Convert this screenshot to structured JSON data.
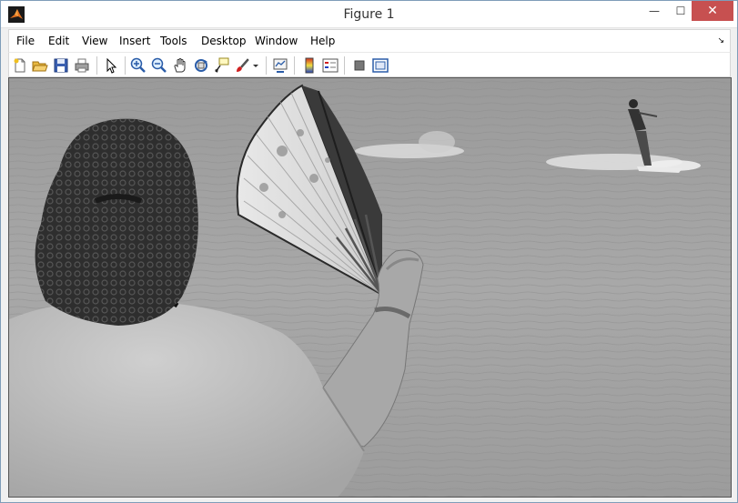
{
  "window": {
    "title": "Figure 1",
    "minimize_glyph": "—",
    "maximize_glyph": "☐",
    "close_glyph": "✕"
  },
  "menubar": {
    "items": [
      "File",
      "Edit",
      "View",
      "Insert",
      "Tools",
      "Desktop",
      "Window",
      "Help"
    ],
    "overflow_glyph": "↘"
  },
  "toolbar": {
    "icons": [
      "new-figure-icon",
      "open-file-icon",
      "save-figure-icon",
      "print-figure-icon",
      "edit-plot-icon",
      "zoom-in-icon",
      "zoom-out-icon",
      "pan-icon",
      "rotate-3d-icon",
      "data-cursor-icon",
      "brush-icon",
      "brush-dropdown-icon",
      "link-plot-icon",
      "insert-colorbar-icon",
      "insert-legend-icon",
      "hide-plot-tools-icon",
      "show-plot-tools-icon"
    ]
  },
  "colors": {
    "close_button": "#c75050",
    "window_border": "#7f9db9",
    "toolbar_bg": "#ffffff"
  },
  "figure": {
    "image_description_visible": false
  }
}
